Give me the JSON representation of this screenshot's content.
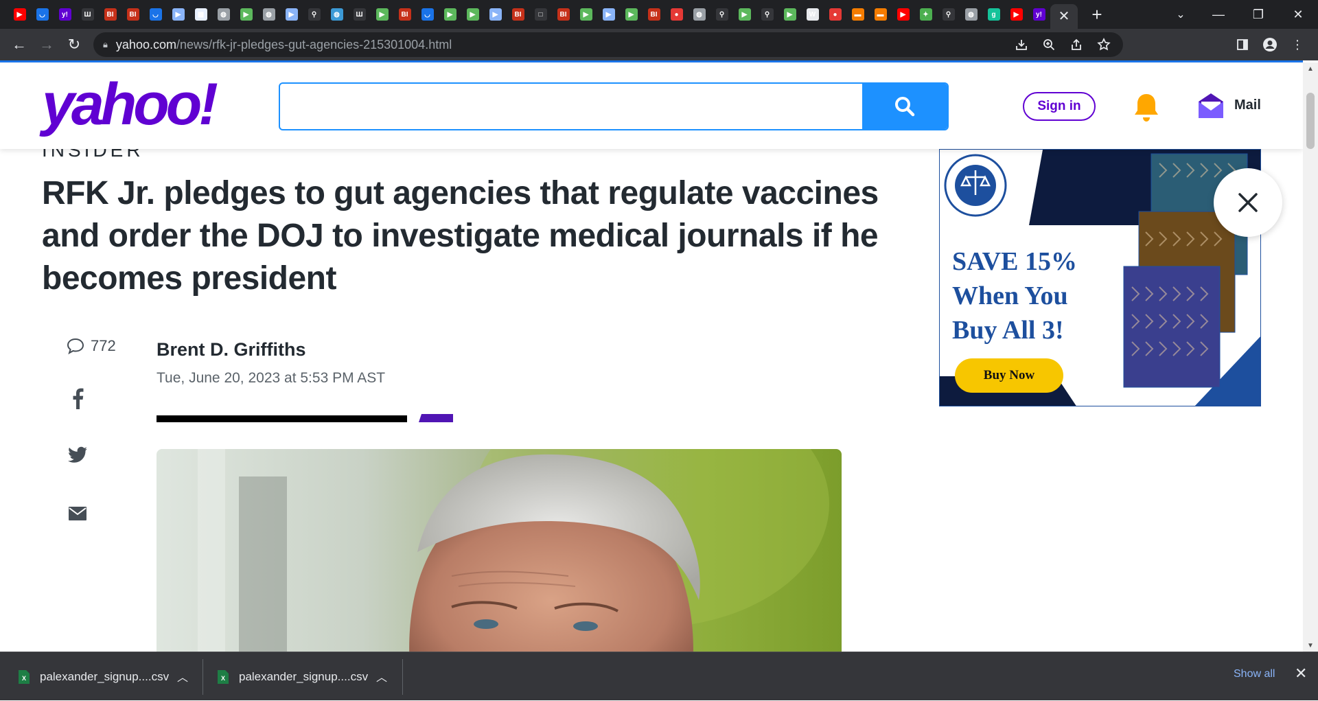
{
  "browser": {
    "tabs": [
      {
        "icon": "youtube-icon",
        "color": "#ff0000",
        "glyph": "▶"
      },
      {
        "icon": "shield-icon",
        "color": "#1a73e8",
        "glyph": "◡"
      },
      {
        "icon": "yahoo-icon",
        "color": "#6001d2",
        "glyph": "y!"
      },
      {
        "icon": "wp-icon",
        "color": "#35363a",
        "glyph": "Ш"
      },
      {
        "icon": "bi-icon",
        "color": "#c6311a",
        "glyph": "BI"
      },
      {
        "icon": "bi-icon",
        "color": "#c6311a",
        "glyph": "BI"
      },
      {
        "icon": "shield-icon",
        "color": "#1a73e8",
        "glyph": "◡"
      },
      {
        "icon": "bookmark-icon",
        "color": "#8ab4f8",
        "glyph": "▶"
      },
      {
        "icon": "sheet-icon",
        "color": "#e8f0fe",
        "glyph": "▦"
      },
      {
        "icon": "globe-icon",
        "color": "#9aa0a6",
        "glyph": "◍"
      },
      {
        "icon": "play-icon",
        "color": "#5cb85c",
        "glyph": "▶"
      },
      {
        "icon": "globe-icon",
        "color": "#9aa0a6",
        "glyph": "◍"
      },
      {
        "icon": "bookmark-icon",
        "color": "#8ab4f8",
        "glyph": "▶"
      },
      {
        "icon": "search-icon",
        "color": "#35363a",
        "glyph": "⚲"
      },
      {
        "icon": "globe-icon",
        "color": "#3c9ad6",
        "glyph": "◍"
      },
      {
        "icon": "wp-icon",
        "color": "#35363a",
        "glyph": "Ш"
      },
      {
        "icon": "play-icon",
        "color": "#5cb85c",
        "glyph": "▶"
      },
      {
        "icon": "bi-icon",
        "color": "#c6311a",
        "glyph": "BI"
      },
      {
        "icon": "shield-icon",
        "color": "#1a73e8",
        "glyph": "◡"
      },
      {
        "icon": "play-icon",
        "color": "#5cb85c",
        "glyph": "▶"
      },
      {
        "icon": "play-icon",
        "color": "#5cb85c",
        "glyph": "▶"
      },
      {
        "icon": "bookmark-icon",
        "color": "#8ab4f8",
        "glyph": "▶"
      },
      {
        "icon": "bi-icon",
        "color": "#c6311a",
        "glyph": "BI"
      },
      {
        "icon": "blank-icon",
        "color": "#35363a",
        "glyph": "□"
      },
      {
        "icon": "bi-icon",
        "color": "#c6311a",
        "glyph": "BI"
      },
      {
        "icon": "play-icon",
        "color": "#5cb85c",
        "glyph": "▶"
      },
      {
        "icon": "bookmark-icon",
        "color": "#8ab4f8",
        "glyph": "▶"
      },
      {
        "icon": "play-icon",
        "color": "#5cb85c",
        "glyph": "▶"
      },
      {
        "icon": "bi-icon",
        "color": "#c6311a",
        "glyph": "BI"
      },
      {
        "icon": "podcast-icon",
        "color": "#e53935",
        "glyph": "●"
      },
      {
        "icon": "globe-icon",
        "color": "#9aa0a6",
        "glyph": "◍"
      },
      {
        "icon": "search-icon",
        "color": "#35363a",
        "glyph": "⚲"
      },
      {
        "icon": "play-icon",
        "color": "#5cb85c",
        "glyph": "▶"
      },
      {
        "icon": "search-icon",
        "color": "#35363a",
        "glyph": "⚲"
      },
      {
        "icon": "play-icon",
        "color": "#5cb85c",
        "glyph": "▶"
      },
      {
        "icon": "news-icon",
        "color": "#e8eaed",
        "glyph": "W"
      },
      {
        "icon": "podcast-icon",
        "color": "#e53935",
        "glyph": "●"
      },
      {
        "icon": "bookmark-orange-icon",
        "color": "#f57c00",
        "glyph": "▬"
      },
      {
        "icon": "bookmark-orange-icon",
        "color": "#f57c00",
        "glyph": "▬"
      },
      {
        "icon": "youtube-icon",
        "color": "#ff0000",
        "glyph": "▶"
      },
      {
        "icon": "app-icon",
        "color": "#4caf50",
        "glyph": "✦"
      },
      {
        "icon": "search-icon",
        "color": "#35363a",
        "glyph": "⚲"
      },
      {
        "icon": "globe-icon",
        "color": "#9aa0a6",
        "glyph": "◍"
      },
      {
        "icon": "grammarly-icon",
        "color": "#15c39a",
        "glyph": "g"
      },
      {
        "icon": "youtube-icon",
        "color": "#ff0000",
        "glyph": "▶"
      },
      {
        "icon": "yahoo-icon",
        "color": "#6001d2",
        "glyph": "y!"
      }
    ],
    "active_tab": {
      "icon": "close-icon",
      "glyph": "✕"
    },
    "new_tab": "+",
    "url_host": "yahoo.com",
    "url_path": "/news/rfk-jr-pledges-gut-agencies-215301004.html"
  },
  "header": {
    "logo": "yahoo!",
    "search_placeholder": "",
    "signin": "Sign in",
    "mail": "Mail"
  },
  "article": {
    "publisher": "INSIDER",
    "headline": "RFK Jr. pledges to gut agencies that regulate vaccines and order the DOJ to investigate medical journals if he becomes president",
    "comments_count": "772",
    "author": "Brent D. Griffiths",
    "date": "Tue, June 20, 2023 at 5:53 PM AST"
  },
  "ad": {
    "headline_lines": [
      "SAVE 15%",
      "When You",
      "Buy All 3!"
    ],
    "button": "Buy Now",
    "colors": {
      "navy": "#0d1b3e",
      "blue": "#1d4f9e",
      "yellow": "#f7c600"
    }
  },
  "downloads": {
    "items": [
      {
        "filename": "palexander_signup....csv"
      },
      {
        "filename": "palexander_signup....csv"
      }
    ],
    "show_all": "Show all"
  }
}
